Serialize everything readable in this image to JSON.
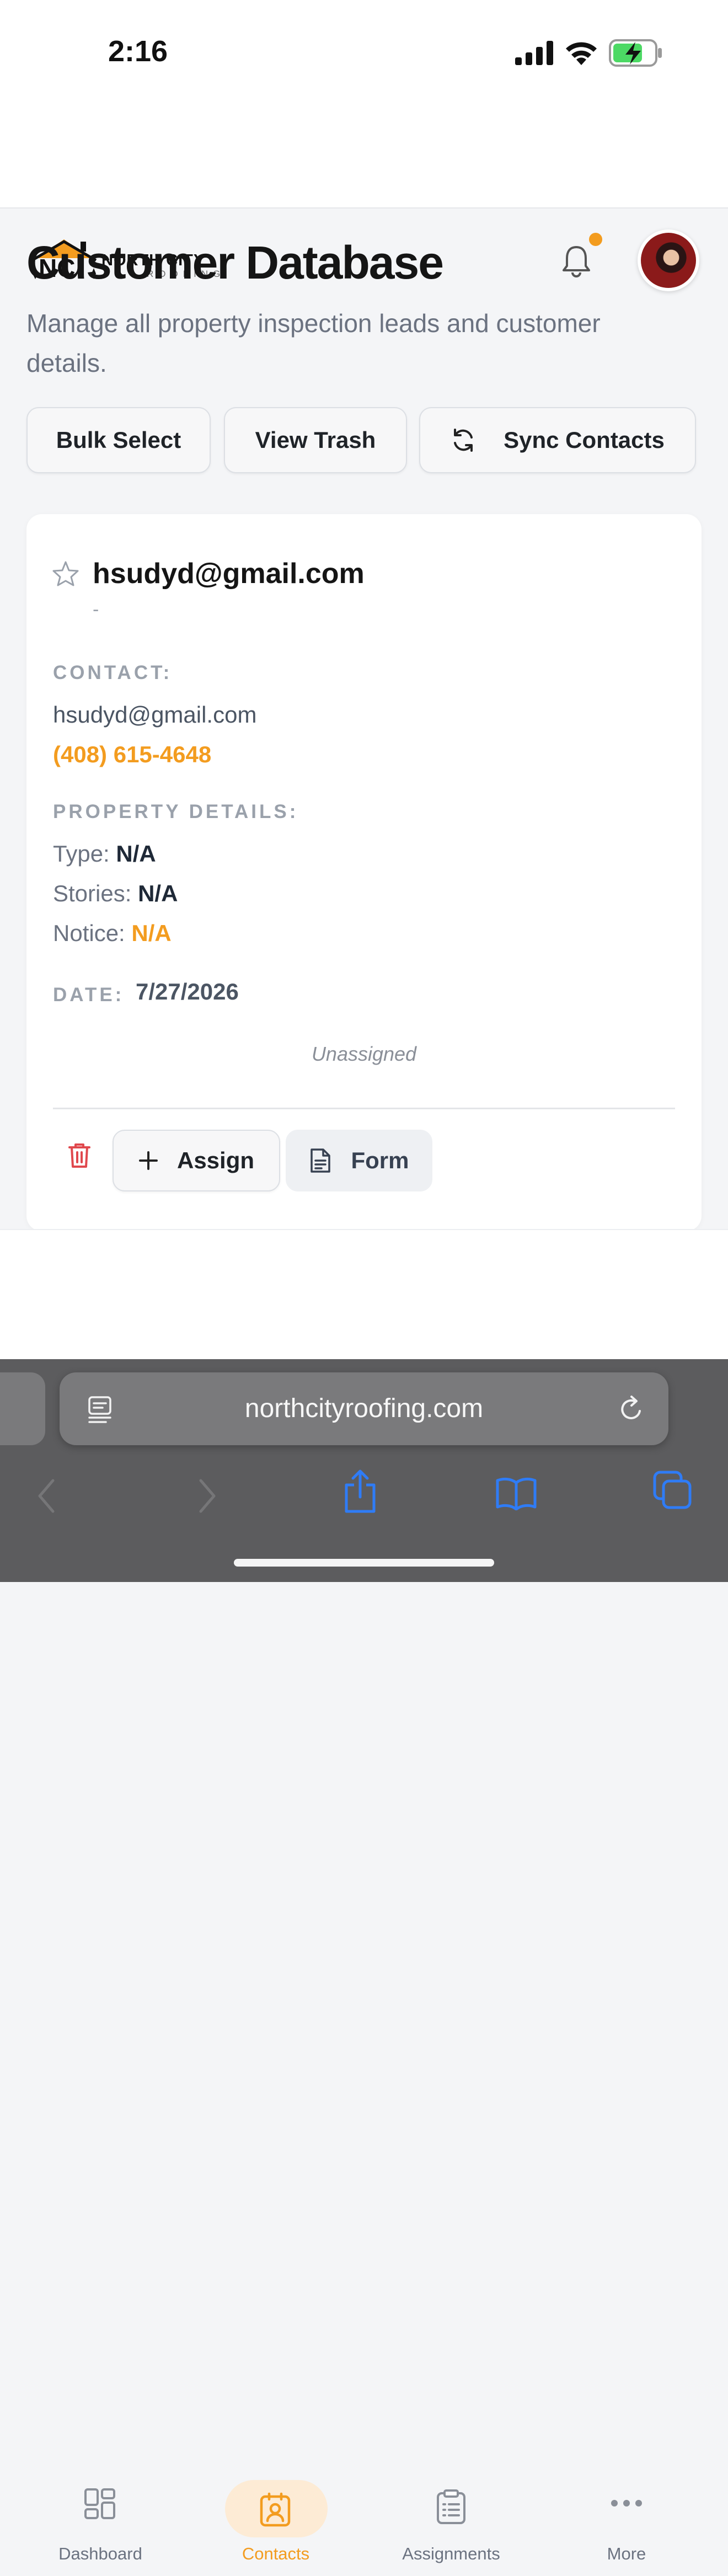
{
  "status_bar": {
    "time": "2:16"
  },
  "header": {
    "brand_name": "NORTH CITY",
    "brand_sub": "ROOFING",
    "notification_dot_color": "#f39c1f"
  },
  "page": {
    "title": "Customer Database",
    "subtitle": "Manage all property inspection leads and customer details."
  },
  "actions": {
    "bulk_select": "Bulk Select",
    "view_trash": "View Trash",
    "sync_contacts": "Sync Contacts"
  },
  "card": {
    "name": "hsudyd@gmail.com",
    "name_sub": "-",
    "contact_label": "CONTACT:",
    "email": "hsudyd@gmail.com",
    "phone": "(408) 615-4648",
    "property_label": "PROPERTY DETAILS:",
    "type_label": "Type:",
    "type_value": "N/A",
    "stories_label": "Stories:",
    "stories_value": "N/A",
    "notice_label": "Notice:",
    "notice_value": "N/A",
    "date_label": "DATE:",
    "date_value": "7/27/2026",
    "assignee": "Unassigned",
    "assign_button": "Assign",
    "form_button": "Form"
  },
  "nav": {
    "items": [
      {
        "label": "Dashboard",
        "icon": "dashboard-grid-icon",
        "active": false
      },
      {
        "label": "Contacts",
        "icon": "contact-card-icon",
        "active": true
      },
      {
        "label": "Assignments",
        "icon": "clipboard-icon",
        "active": false
      },
      {
        "label": "More",
        "icon": "more-dots-icon",
        "active": false
      }
    ],
    "active_color": "#f39c1f"
  },
  "browser": {
    "url": "northcityroofing.com"
  }
}
